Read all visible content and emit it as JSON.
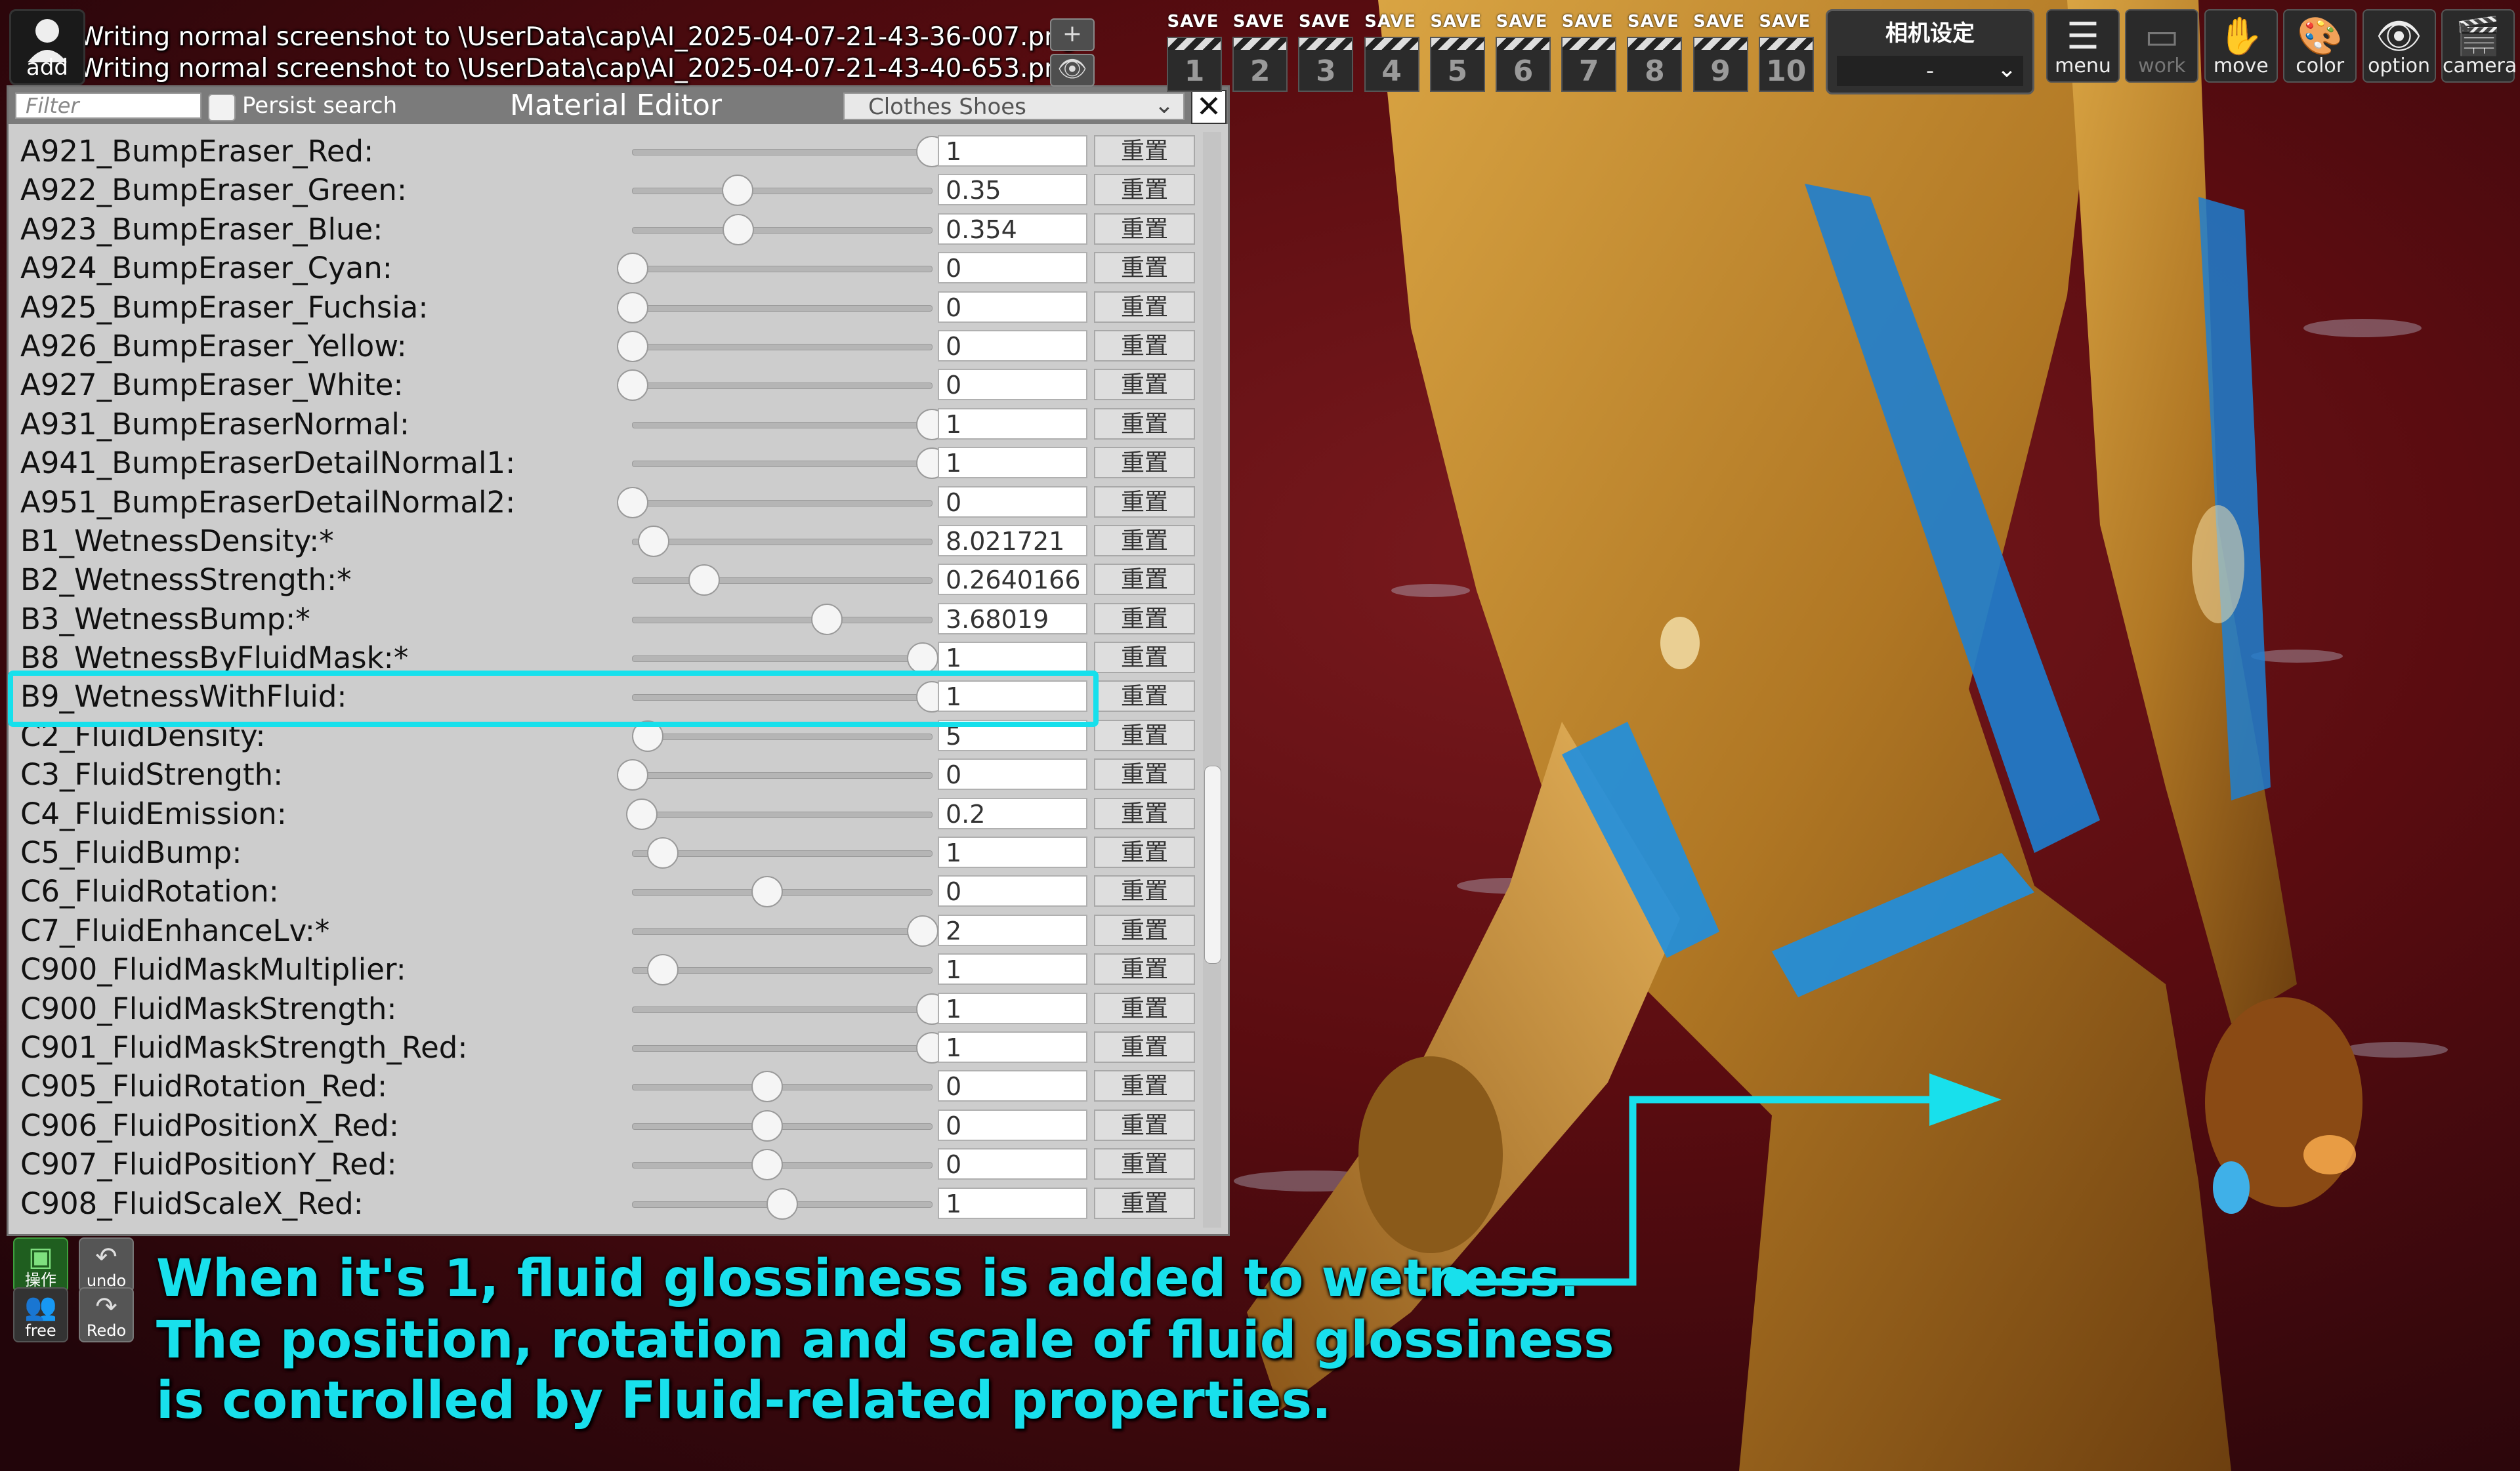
{
  "log": {
    "line1": "Writing normal screenshot to \\UserData\\cap\\AI_2025-04-07-21-43-36-007.png",
    "line2": "Writing normal screenshot to \\UserData\\cap\\AI_2025-04-07-21-43-40-653.png"
  },
  "topbar": {
    "add_label": "add",
    "plus_label": "+",
    "eye_label": "👁",
    "save_tag": "SAVE",
    "save_slots": [
      "1",
      "2",
      "3",
      "4",
      "5",
      "6",
      "7",
      "8",
      "9",
      "10"
    ],
    "camera_settings_title": "相机设定",
    "camera_settings_value": "-",
    "tools": [
      {
        "label": "menu",
        "icon": "☰"
      },
      {
        "label": "work",
        "icon": "▭"
      },
      {
        "label": "move",
        "icon": "✋"
      },
      {
        "label": "color",
        "icon": "🎨"
      },
      {
        "label": "option",
        "icon": "👁"
      },
      {
        "label": "camera",
        "icon": "🎬"
      }
    ]
  },
  "editor": {
    "filter_placeholder": "Filter",
    "persist_label": "Persist search",
    "title": "Material Editor",
    "category": "Clothes Shoes",
    "close_label": "✕",
    "reset_label": "重置",
    "rows": [
      {
        "name": "A921_BumpEraser_Red:",
        "value": "1",
        "level": 1.0
      },
      {
        "name": "A922_BumpEraser_Green:",
        "value": "0.35",
        "level": 0.35
      },
      {
        "name": "A923_BumpEraser_Blue:",
        "value": "0.354",
        "level": 0.354
      },
      {
        "name": "A924_BumpEraser_Cyan:",
        "value": "0",
        "level": 0.0
      },
      {
        "name": "A925_BumpEraser_Fuchsia:",
        "value": "0",
        "level": 0.0
      },
      {
        "name": "A926_BumpEraser_Yellow:",
        "value": "0",
        "level": 0.0
      },
      {
        "name": "A927_BumpEraser_White:",
        "value": "0",
        "level": 0.0
      },
      {
        "name": "A931_BumpEraserNormal:",
        "value": "1",
        "level": 1.0
      },
      {
        "name": "A941_BumpEraserDetailNormal1:",
        "value": "1",
        "level": 1.0
      },
      {
        "name": "A951_BumpEraserDetailNormal2:",
        "value": "0",
        "level": 0.0
      },
      {
        "name": "B1_WetnessDensity:*",
        "value": "8.021721",
        "level": 0.07
      },
      {
        "name": "B2_WetnessStrength:*",
        "value": "0.2640166",
        "level": 0.24
      },
      {
        "name": "B3_WetnessBump:*",
        "value": "3.68019",
        "level": 0.65
      },
      {
        "name": "B8_WetnessByFluidMask:*",
        "value": "1",
        "level": 0.97
      },
      {
        "name": "B9_WetnessWithFluid:",
        "value": "1",
        "level": 1.0
      },
      {
        "name": "C2_FluidDensity:",
        "value": "5",
        "level": 0.05
      },
      {
        "name": "C3_FluidStrength:",
        "value": "0",
        "level": 0.0
      },
      {
        "name": "C4_FluidEmission:",
        "value": "0.2",
        "level": 0.03
      },
      {
        "name": "C5_FluidBump:",
        "value": "1",
        "level": 0.1
      },
      {
        "name": "C6_FluidRotation:",
        "value": "0",
        "level": 0.45
      },
      {
        "name": "C7_FluidEnhanceLv:*",
        "value": "2",
        "level": 0.97
      },
      {
        "name": "C900_FluidMaskMultiplier:",
        "value": "1",
        "level": 0.1
      },
      {
        "name": "C900_FluidMaskStrength:",
        "value": "1",
        "level": 1.0
      },
      {
        "name": "C901_FluidMaskStrength_Red:",
        "value": "1",
        "level": 1.0
      },
      {
        "name": "C905_FluidRotation_Red:",
        "value": "0",
        "level": 0.45
      },
      {
        "name": "C906_FluidPositionX_Red:",
        "value": "0",
        "level": 0.45
      },
      {
        "name": "C907_FluidPositionY_Red:",
        "value": "0",
        "level": 0.45
      },
      {
        "name": "C908_FluidScaleX_Red:",
        "value": "1",
        "level": 0.5
      }
    ]
  },
  "bottom": {
    "chara_label": "操作",
    "undo_label": "undo",
    "free_label": "free",
    "redo_label": "Redo"
  },
  "annotation": {
    "line1": "When it's 1, fluid glossiness is added to wetness.",
    "line2": "The position, rotation and scale of fluid glossiness",
    "line3": "is controlled by Fluid-related properties.",
    "color": "#18e0ec"
  }
}
